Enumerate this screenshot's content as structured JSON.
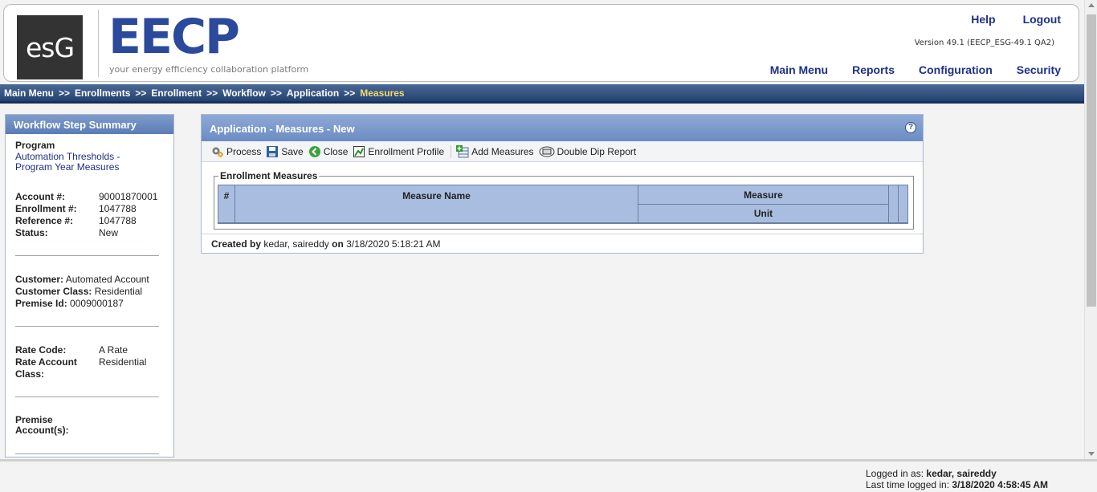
{
  "header": {
    "logo_text": "esG",
    "brand": "EECP",
    "tagline": "your energy efficiency collaboration platform",
    "help": "Help",
    "logout": "Logout",
    "version": "Version 49.1 (EECP_ESG-49.1 QA2)",
    "nav": [
      "Main Menu",
      "Reports",
      "Configuration",
      "Security"
    ]
  },
  "breadcrumb": {
    "items": [
      "Main Menu",
      "Enrollments",
      "Enrollment",
      "Workflow",
      "Application"
    ],
    "separator": ">>",
    "current": "Measures"
  },
  "sidebar": {
    "title": "Workflow Step Summary",
    "program_label": "Program",
    "program_link": "Automation Thresholds - Program Year Measures",
    "account_label": "Account #:",
    "account": "90001870001",
    "enrollment_label": "Enrollment #:",
    "enrollment": "1047788",
    "reference_label": "Reference #:",
    "reference": "1047788",
    "status_label": "Status:",
    "status": "New",
    "customer_label": "Customer:",
    "customer": "Automated Account",
    "customer_class_label": "Customer Class:",
    "customer_class": "Residential",
    "premise_id_label": "Premise Id:",
    "premise_id": "0009000187",
    "rate_code_label": "Rate Code:",
    "rate_code": "A Rate",
    "rate_account_class_label": "Rate Account Class:",
    "rate_account_class": "Residential",
    "premise_accounts_label": "Premise Account(s):"
  },
  "panel": {
    "title": "Application - Measures - New",
    "help_icon": "?",
    "toolbar": {
      "process": "Process",
      "save": "Save",
      "close": "Close",
      "enrollment_profile": "Enrollment Profile",
      "add_measures": "Add Measures",
      "double_dip_report": "Double Dip Report"
    },
    "fieldset_legend": "Enrollment Measures",
    "grid": {
      "col_num": "#",
      "col_measure_name": "Measure Name",
      "col_measure": "Measure",
      "col_unit": "Unit"
    },
    "created_by_label": "Created by",
    "created_by": "kedar, saireddy",
    "on_label": "on",
    "created_on": "3/18/2020 5:18:21 AM"
  },
  "footer": {
    "logged_in_label": "Logged in as:",
    "logged_in_user": "kedar, saireddy",
    "last_login_label": "Last time logged in:",
    "last_login": "3/18/2020 4:58:45 AM"
  }
}
